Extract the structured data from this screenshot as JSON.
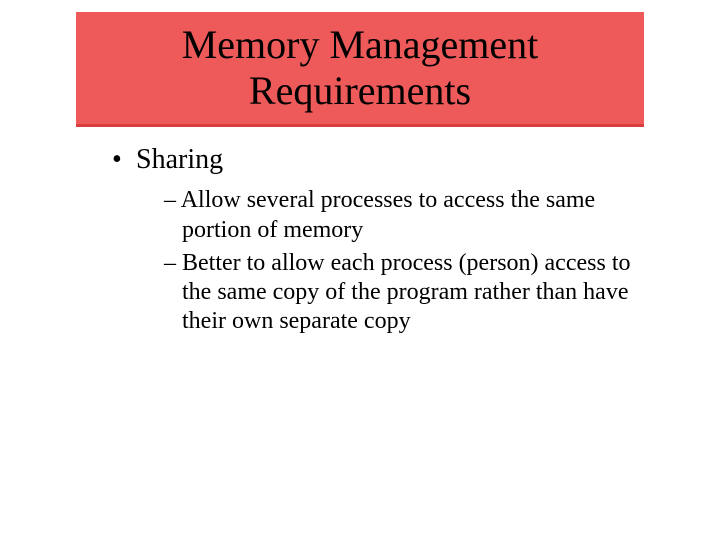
{
  "title": "Memory Management Requirements",
  "bullet": {
    "label": "Sharing",
    "sub_items": [
      "Allow several processes to access the same portion of memory",
      "Better to allow each process (person) access to the same copy of the program rather than have their own separate copy"
    ]
  }
}
